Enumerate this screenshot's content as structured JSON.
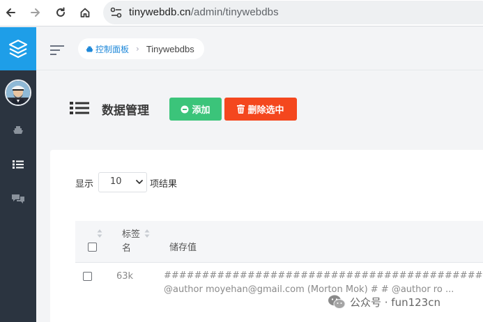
{
  "browser": {
    "url_host": "tinywebdb.cn",
    "url_path": "/admin/tinywebdbs"
  },
  "breadcrumb": {
    "home": "控制面板",
    "current": "Tinywebdbs"
  },
  "page": {
    "title": "数据管理",
    "add_button": "添加",
    "delete_button": "删除选中"
  },
  "length": {
    "show_label": "显示",
    "selected": "10",
    "result_label": "项结果"
  },
  "table": {
    "columns": [
      "标签名",
      "储存值"
    ],
    "rows": [
      {
        "tag": "63k",
        "value_line1": "############################################ # @au",
        "value_line2": "@author moyehan@gmail.com (Morton Mok) # # @author ro ..."
      }
    ]
  },
  "watermark": {
    "text": "公众号 · fun123cn"
  },
  "colors": {
    "sidebar": "#2b3440",
    "logo": "#1e9ee8",
    "add": "#3bc47a",
    "delete": "#f4471e",
    "link": "#1e88d9"
  }
}
